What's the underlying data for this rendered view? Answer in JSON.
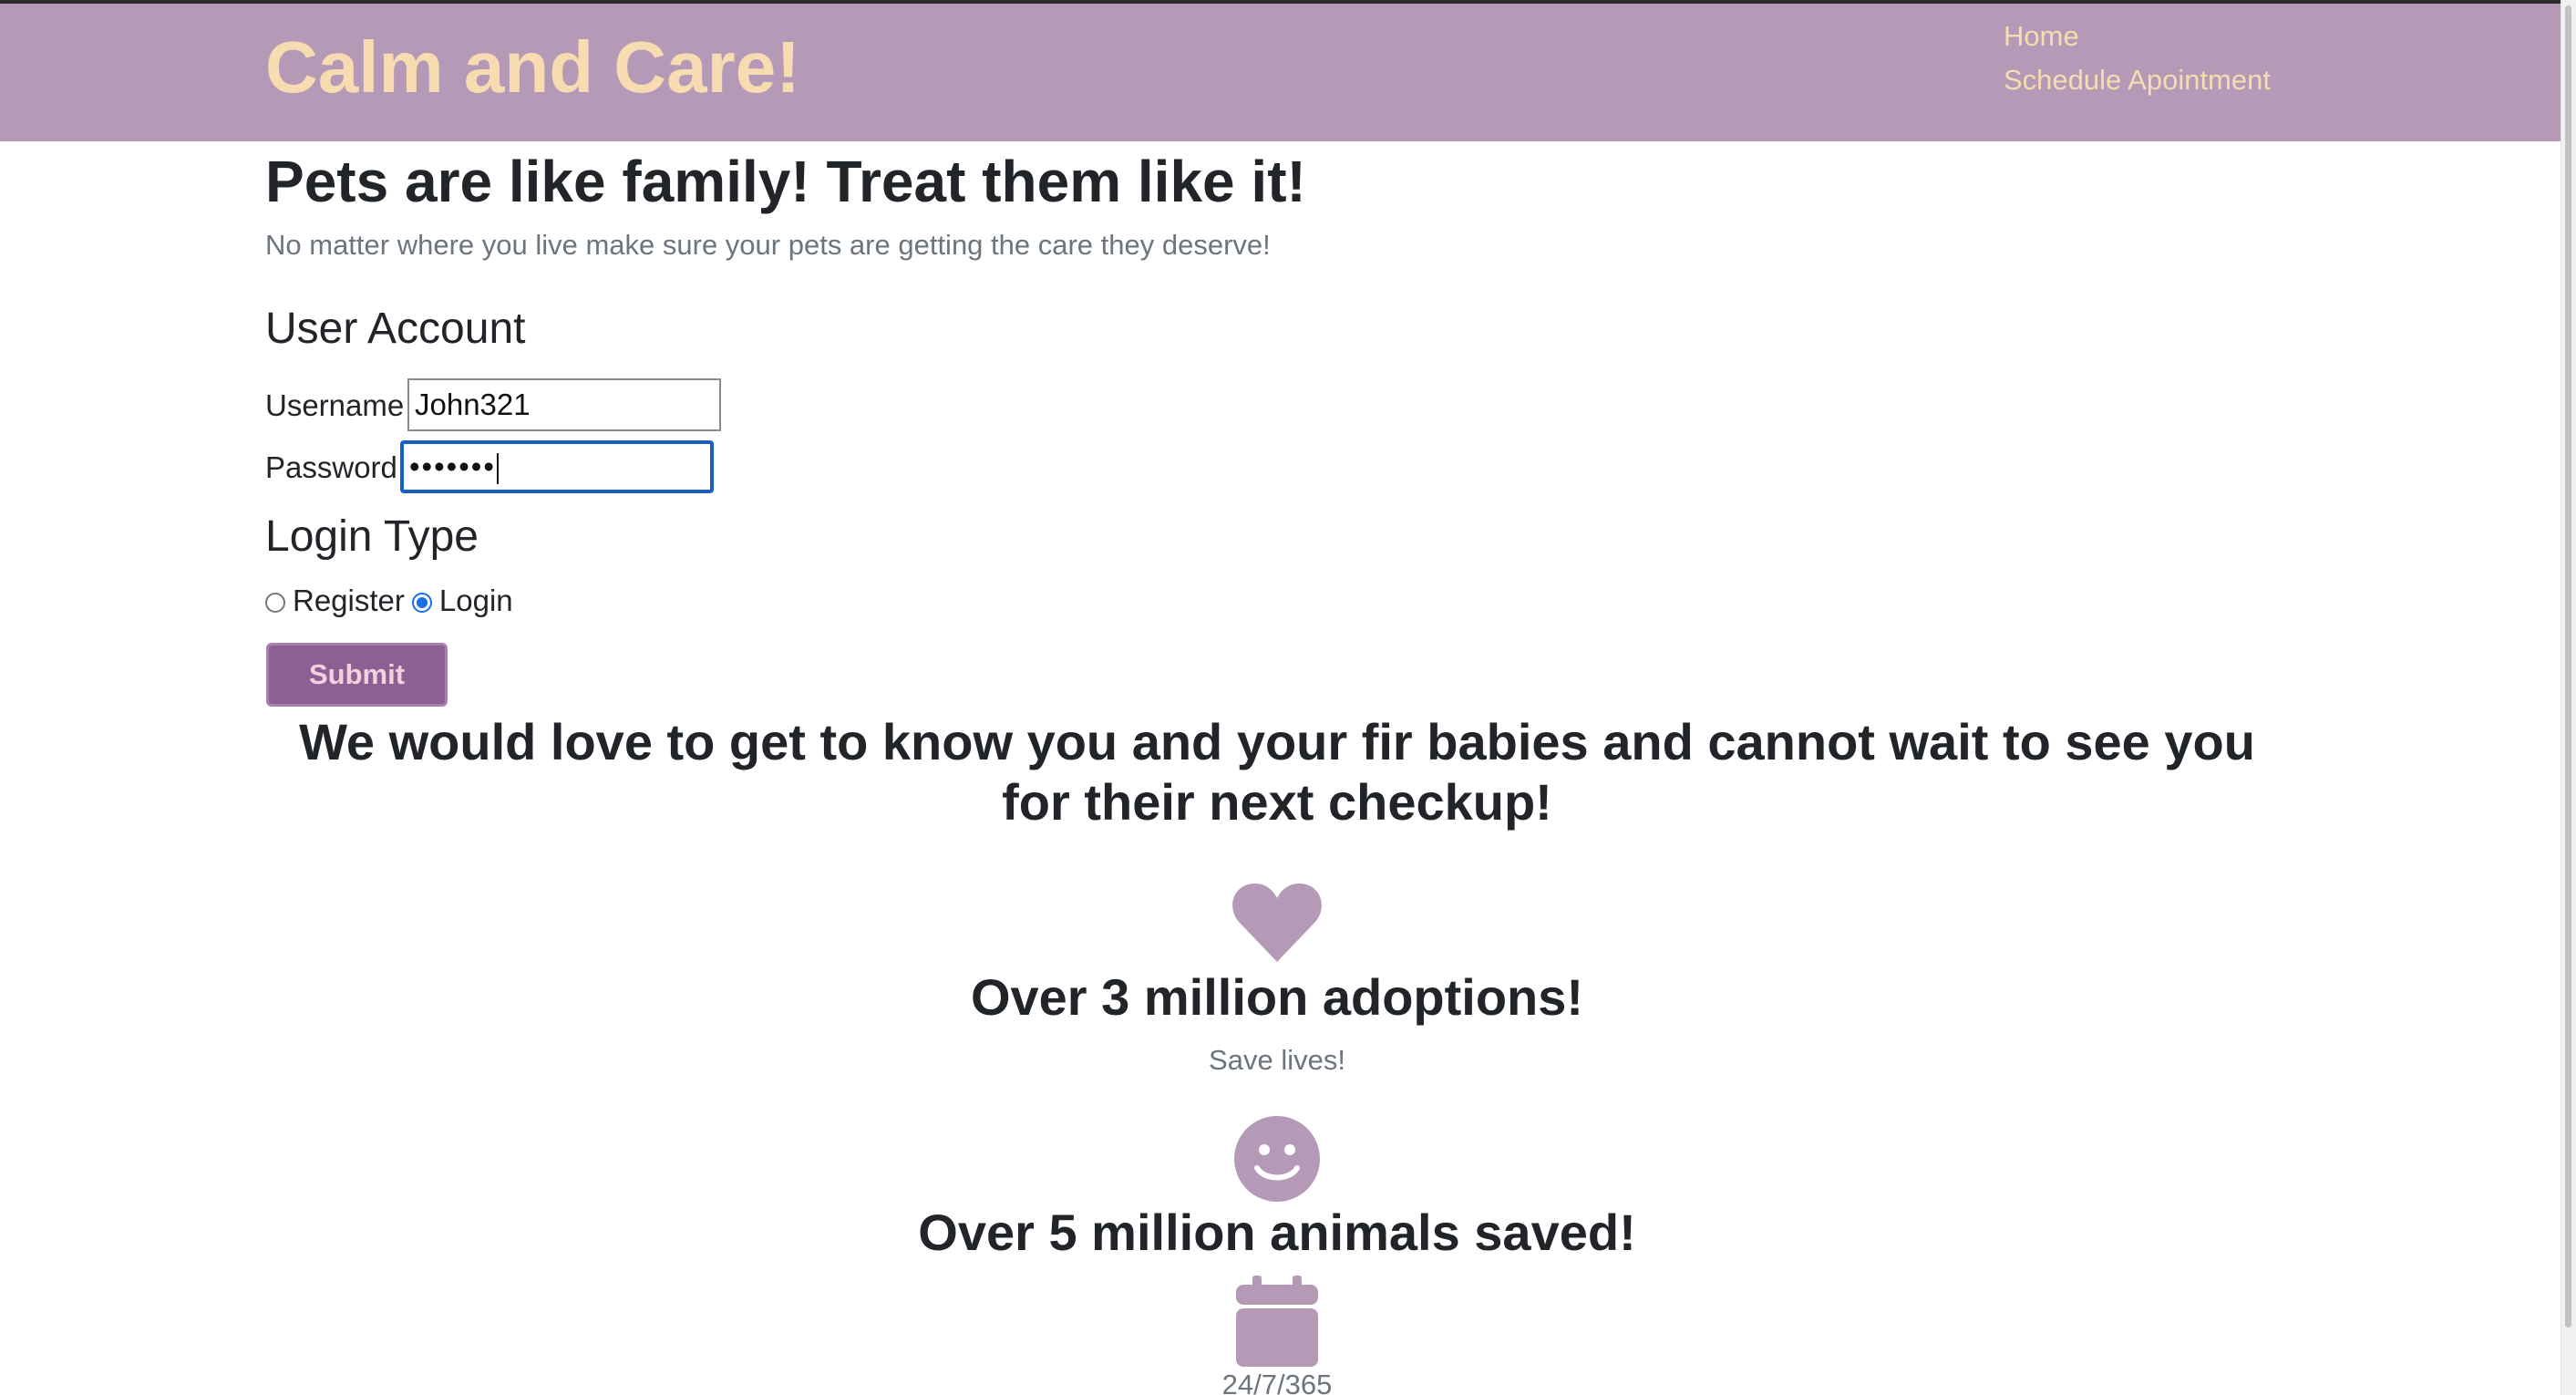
{
  "header": {
    "brand": "Calm and Care!",
    "nav": {
      "home": "Home",
      "schedule": "Schedule Apointment"
    }
  },
  "hero": {
    "headline": "Pets are like family! Treat them like it!",
    "lead": "No matter where you live make sure your pets are getting the care they deserve!"
  },
  "account": {
    "title": "User Account",
    "username_label": "Username",
    "username_value": "John321",
    "password_label": "Password",
    "password_value": "•••••••"
  },
  "login_type": {
    "title": "Login Type",
    "options": [
      "Register",
      "Login"
    ],
    "selected": "Login"
  },
  "submit_label": "Submit",
  "invite": "We would love to get to know you and your fir babies and cannot wait to see you for their next checkup!",
  "features": [
    {
      "icon": "heart-icon",
      "title": "Over 3 million adoptions!",
      "text": "Save lives!"
    },
    {
      "icon": "smile-icon",
      "title": "Over 5 million animals saved!",
      "text": ""
    },
    {
      "icon": "calendar-icon",
      "title": "",
      "text": "24/7/365"
    }
  ],
  "colors": {
    "header_bg": "#b59ab8",
    "brand_text": "#f6dcb0",
    "icon": "#b59ab8",
    "submit_bg": "#8e5f93",
    "focus_border": "#1a5fc4"
  }
}
